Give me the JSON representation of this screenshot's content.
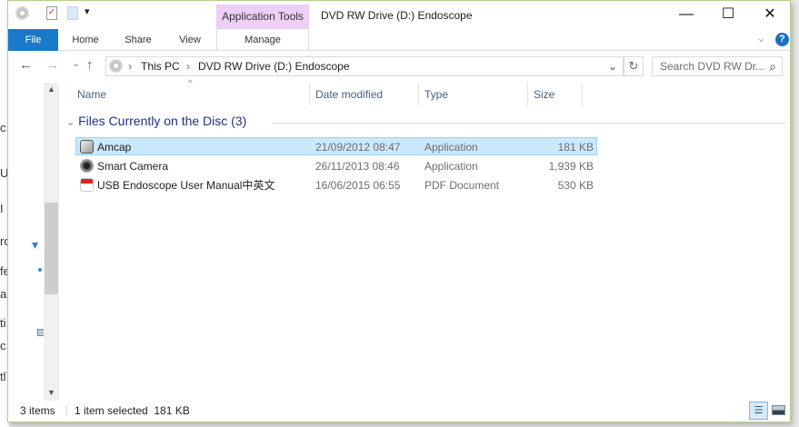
{
  "background_window": {
    "fragments": [
      "c",
      "U",
      "I",
      "ro",
      "fe",
      "a",
      "ti",
      "c",
      "tl"
    ]
  },
  "titlebar": {
    "title": "DVD RW Drive (D:) Endoscope",
    "context_tab_group": "Application Tools",
    "minimize": "—",
    "maximize": "☐",
    "close": "✕"
  },
  "ribbon": {
    "tabs": [
      "File",
      "Home",
      "Share",
      "View",
      "Manage"
    ],
    "help": "?",
    "collapse": "⌄"
  },
  "address": {
    "back": "←",
    "forward": "→",
    "recent": "⌄",
    "up": "↑",
    "crumbs": [
      "This PC",
      "DVD RW Drive (D:) Endoscope"
    ],
    "sep": "›",
    "dropdown": "⌄",
    "refresh": "↻"
  },
  "search": {
    "placeholder": "Search DVD RW Dr...",
    "icon": "⌕"
  },
  "columns": [
    "Name",
    "Date modified",
    "Type",
    "Size"
  ],
  "group": {
    "label": "Files Currently on the Disc (3)",
    "chevron": "⌄"
  },
  "files": [
    {
      "name": "Amcap",
      "date": "21/09/2012 08:47",
      "type": "Application",
      "size": "181 KB",
      "selected": true,
      "icon": "camera-app-icon"
    },
    {
      "name": "Smart Camera",
      "date": "26/11/2013 08:46",
      "type": "Application",
      "size": "1,939 KB",
      "selected": false,
      "icon": "webcam-icon"
    },
    {
      "name": "USB Endoscope User Manual中英文",
      "date": "16/06/2015 06:55",
      "type": "PDF Document",
      "size": "530 KB",
      "selected": false,
      "icon": "pdf-icon"
    }
  ],
  "status": {
    "items": "3 items",
    "selection": "1 item selected  181 KB"
  },
  "colors": {
    "accent": "#1979ca",
    "selection": "#cce8ff",
    "context_tab": "#eecff7"
  }
}
